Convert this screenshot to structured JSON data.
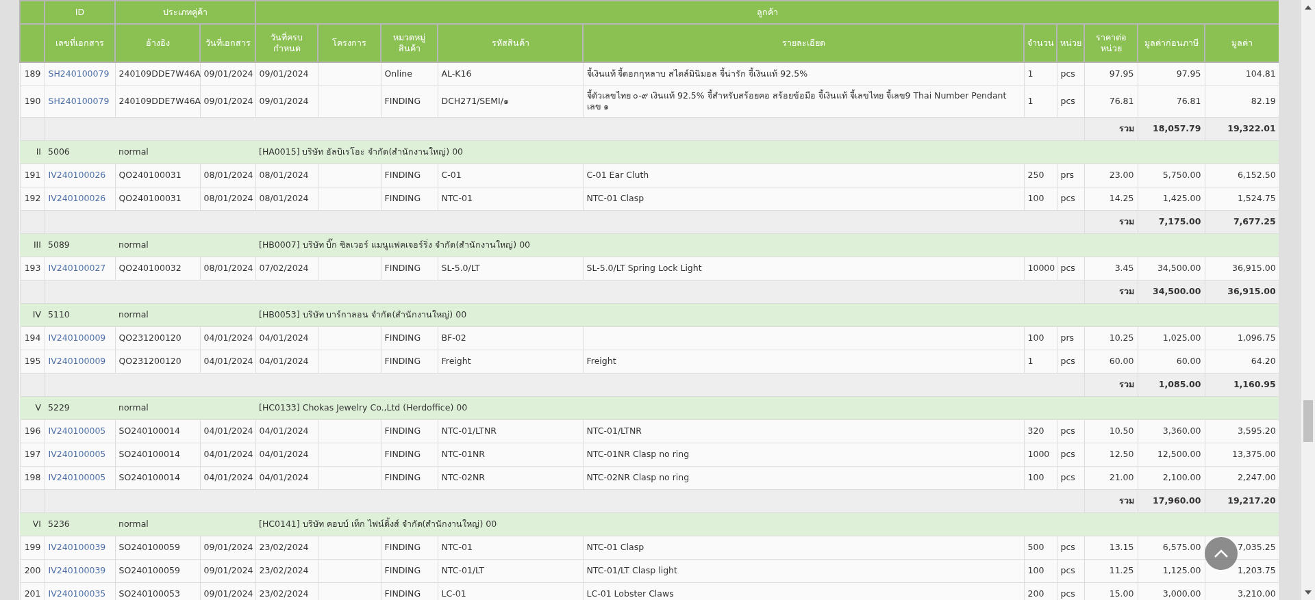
{
  "header_groups": [
    {
      "label": "ID"
    },
    {
      "label": "ประเภทคู่ค้า"
    },
    {
      "label": "ลูกค้า"
    }
  ],
  "columns": [
    "เลขที่เอกสาร",
    "อ้างอิง",
    "วันที่เอกสาร",
    "วันที่ครบ\nกำหนด",
    "โครงการ",
    "หมวดหมู่\nสินค้า",
    "รหัสสินค้า",
    "รายละเอียด",
    "จำนวน",
    "หน่วย",
    "ราคาต่อ\nหน่วย",
    "มูลค่าก่อนภาษี",
    "มูลค่า"
  ],
  "rows": [
    {
      "kind": "item",
      "no": "189",
      "doc": "SH240100079",
      "ref": "240109DDE7W46A",
      "doc_date": "09/01/2024",
      "due_date": "09/01/2024",
      "category": "Online",
      "sku": "AL-K16",
      "description": "จี้เงินแท้ จี้ดอกกุหลาบ สไตล์มินิมอล จี้น่ารัก จี้เงินแท้ 92.5%",
      "qty": "1",
      "unit": "pcs",
      "price": "97.95",
      "pretax": "97.95",
      "value": "104.81"
    },
    {
      "kind": "item",
      "no": "190",
      "doc": "SH240100079",
      "ref": "240109DDE7W46A",
      "doc_date": "09/01/2024",
      "due_date": "09/01/2024",
      "category": "FINDING",
      "sku": "DCH271/SEMI/๑",
      "description": "จี้ตัวเลขไทย ๐-๙ เงินแท้ 92.5% จี้สำหรับสร้อยคอ สร้อยข้อมือ จี้เงินแท้ จี้เลขไทย จี้เลข9 Thai Number Pendant เลข ๑",
      "qty": "1",
      "unit": "pcs",
      "price": "76.81",
      "pretax": "76.81",
      "value": "82.19"
    },
    {
      "kind": "total",
      "label": "รวม",
      "pretax": "18,057.79",
      "value": "19,322.01"
    },
    {
      "kind": "group",
      "no": "II",
      "id": "5006",
      "type": "normal",
      "customer": "[HA0015] บริษัท อัลบิเรโอะ จำกัด(สำนักงานใหญ่) 00"
    },
    {
      "kind": "item",
      "no": "191",
      "doc": "IV240100026",
      "ref": "QO240100031",
      "doc_date": "08/01/2024",
      "due_date": "08/01/2024",
      "category": "FINDING",
      "sku": "C-01",
      "description": "C-01 Ear Cluth",
      "qty": "250",
      "unit": "prs",
      "price": "23.00",
      "pretax": "5,750.00",
      "value": "6,152.50"
    },
    {
      "kind": "item",
      "no": "192",
      "doc": "IV240100026",
      "ref": "QO240100031",
      "doc_date": "08/01/2024",
      "due_date": "08/01/2024",
      "category": "FINDING",
      "sku": "NTC-01",
      "description": "NTC-01 Clasp",
      "qty": "100",
      "unit": "pcs",
      "price": "14.25",
      "pretax": "1,425.00",
      "value": "1,524.75"
    },
    {
      "kind": "total",
      "label": "รวม",
      "pretax": "7,175.00",
      "value": "7,677.25"
    },
    {
      "kind": "group",
      "no": "III",
      "id": "5089",
      "type": "normal",
      "customer": "[HB0007] บริษัท บิ๊ก ซิลเวอร์ แมนูแฟคเจอร์ริ่ง จำกัด(สำนักงานใหญ่) 00"
    },
    {
      "kind": "item",
      "no": "193",
      "doc": "IV240100027",
      "ref": "QO240100032",
      "doc_date": "08/01/2024",
      "due_date": "07/02/2024",
      "category": "FINDING",
      "sku": "SL-5.0/LT",
      "description": "SL-5.0/LT Spring Lock Light",
      "qty": "10000",
      "unit": "pcs",
      "price": "3.45",
      "pretax": "34,500.00",
      "value": "36,915.00"
    },
    {
      "kind": "total",
      "label": "รวม",
      "pretax": "34,500.00",
      "value": "36,915.00"
    },
    {
      "kind": "group",
      "no": "IV",
      "id": "5110",
      "type": "normal",
      "customer": "[HB0053] บริษัท บาร์กาลอน จำกัด(สำนักงานใหญ่) 00"
    },
    {
      "kind": "item",
      "no": "194",
      "doc": "IV240100009",
      "ref": "QO231200120",
      "doc_date": "04/01/2024",
      "due_date": "04/01/2024",
      "category": "FINDING",
      "sku": "BF-02",
      "qty": "100",
      "unit": "prs",
      "price": "10.25",
      "pretax": "1,025.00",
      "value": "1,096.75"
    },
    {
      "kind": "item",
      "no": "195",
      "doc": "IV240100009",
      "ref": "QO231200120",
      "doc_date": "04/01/2024",
      "due_date": "04/01/2024",
      "category": "FINDING",
      "sku": "Freight",
      "description": "Freight",
      "qty": "1",
      "unit": "pcs",
      "price": "60.00",
      "pretax": "60.00",
      "value": "64.20"
    },
    {
      "kind": "total",
      "label": "รวม",
      "pretax": "1,085.00",
      "value": "1,160.95"
    },
    {
      "kind": "group",
      "no": "V",
      "id": "5229",
      "type": "normal",
      "customer": "[HC0133] Chokas Jewelry Co.,Ltd (Herdoffice) 00"
    },
    {
      "kind": "item",
      "no": "196",
      "doc": "IV240100005",
      "ref": "SO240100014",
      "doc_date": "04/01/2024",
      "due_date": "04/01/2024",
      "category": "FINDING",
      "sku": "NTC-01/LTNR",
      "description": "NTC-01/LTNR",
      "qty": "320",
      "unit": "pcs",
      "price": "10.50",
      "pretax": "3,360.00",
      "value": "3,595.20"
    },
    {
      "kind": "item",
      "no": "197",
      "doc": "IV240100005",
      "ref": "SO240100014",
      "doc_date": "04/01/2024",
      "due_date": "04/01/2024",
      "category": "FINDING",
      "sku": "NTC-01NR",
      "description": "NTC-01NR Clasp no ring",
      "qty": "1000",
      "unit": "pcs",
      "price": "12.50",
      "pretax": "12,500.00",
      "value": "13,375.00"
    },
    {
      "kind": "item",
      "no": "198",
      "doc": "IV240100005",
      "ref": "SO240100014",
      "doc_date": "04/01/2024",
      "due_date": "04/01/2024",
      "category": "FINDING",
      "sku": "NTC-02NR",
      "description": "NTC-02NR Clasp no ring",
      "qty": "100",
      "unit": "pcs",
      "price": "21.00",
      "pretax": "2,100.00",
      "value": "2,247.00"
    },
    {
      "kind": "total",
      "label": "รวม",
      "pretax": "17,960.00",
      "value": "19,217.20"
    },
    {
      "kind": "group",
      "no": "VI",
      "id": "5236",
      "type": "normal",
      "customer": "[HC0141] บริษัท คอบบ์ เท็ก ไฟน์ดิ้งส์ จำกัด(สำนักงานใหญ่) 00"
    },
    {
      "kind": "item",
      "no": "199",
      "doc": "IV240100039",
      "ref": "SO240100059",
      "doc_date": "09/01/2024",
      "due_date": "23/02/2024",
      "category": "FINDING",
      "sku": "NTC-01",
      "description": "NTC-01 Clasp",
      "qty": "500",
      "unit": "pcs",
      "price": "13.15",
      "pretax": "6,575.00",
      "value": "7,035.25"
    },
    {
      "kind": "item",
      "no": "200",
      "doc": "IV240100039",
      "ref": "SO240100059",
      "doc_date": "09/01/2024",
      "due_date": "23/02/2024",
      "category": "FINDING",
      "sku": "NTC-01/LT",
      "description": "NTC-01/LT Clasp light",
      "qty": "100",
      "unit": "pcs",
      "price": "11.25",
      "pretax": "1,125.00",
      "value": "1,203.75"
    },
    {
      "kind": "item",
      "no": "201",
      "doc": "IV240100035",
      "ref": "SO240100053",
      "doc_date": "09/01/2024",
      "due_date": "23/02/2024",
      "category": "FINDING",
      "sku": "LC-01",
      "description": "LC-01 Lobster Claws",
      "qty": "200",
      "unit": "pcs",
      "price": "15.00",
      "pretax": "3,000.00",
      "value": "3,210.00"
    }
  ]
}
